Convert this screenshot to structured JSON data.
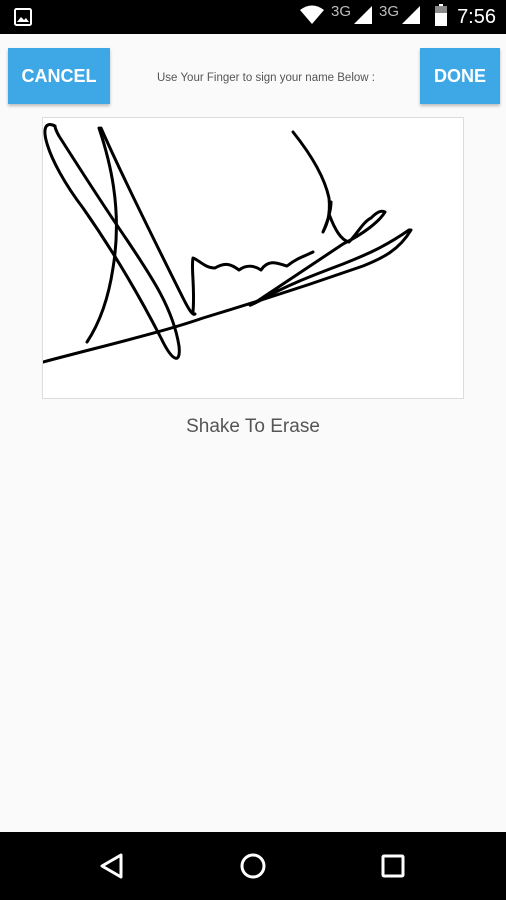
{
  "status_bar": {
    "network_1": "3G",
    "network_2": "3G",
    "time": "7:56"
  },
  "header": {
    "cancel_label": "CANCEL",
    "done_label": "DONE",
    "instruction": "Use Your Finger to sign your name Below :"
  },
  "signature": {
    "hint": "Shake To Erase"
  },
  "colors": {
    "accent": "#3ea8e6",
    "background": "#fafafa",
    "system_bar": "#000000",
    "ink": "#000000"
  },
  "icons": {
    "status_left": "image-icon",
    "wifi": "wifi-icon",
    "signal": "signal-icon",
    "battery": "battery-icon",
    "back": "back-icon",
    "home": "home-icon",
    "recents": "recents-icon"
  }
}
